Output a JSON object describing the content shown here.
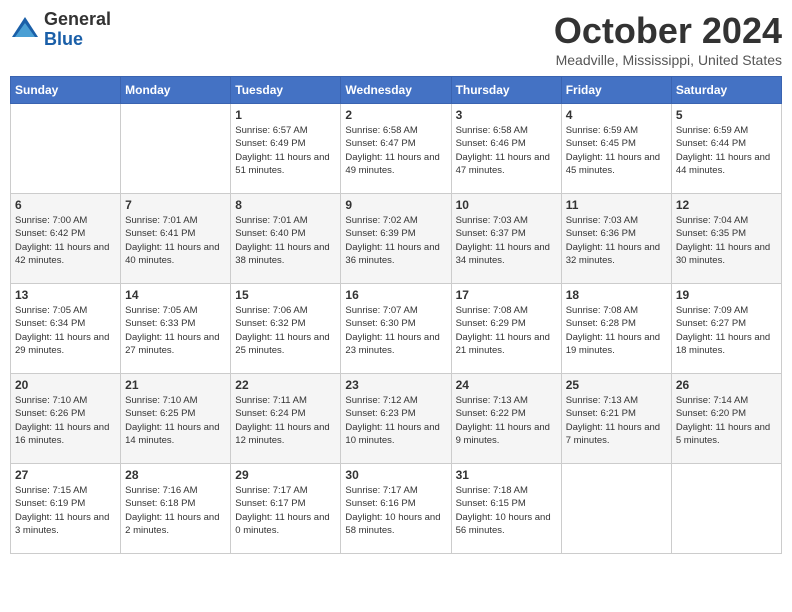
{
  "app": {
    "name_general": "General",
    "name_blue": "Blue"
  },
  "header": {
    "month_title": "October 2024",
    "location": "Meadville, Mississippi, United States"
  },
  "weekdays": [
    "Sunday",
    "Monday",
    "Tuesday",
    "Wednesday",
    "Thursday",
    "Friday",
    "Saturday"
  ],
  "weeks": [
    [
      {
        "day": "",
        "sunrise": "",
        "sunset": "",
        "daylight": ""
      },
      {
        "day": "",
        "sunrise": "",
        "sunset": "",
        "daylight": ""
      },
      {
        "day": "1",
        "sunrise": "Sunrise: 6:57 AM",
        "sunset": "Sunset: 6:49 PM",
        "daylight": "Daylight: 11 hours and 51 minutes."
      },
      {
        "day": "2",
        "sunrise": "Sunrise: 6:58 AM",
        "sunset": "Sunset: 6:47 PM",
        "daylight": "Daylight: 11 hours and 49 minutes."
      },
      {
        "day": "3",
        "sunrise": "Sunrise: 6:58 AM",
        "sunset": "Sunset: 6:46 PM",
        "daylight": "Daylight: 11 hours and 47 minutes."
      },
      {
        "day": "4",
        "sunrise": "Sunrise: 6:59 AM",
        "sunset": "Sunset: 6:45 PM",
        "daylight": "Daylight: 11 hours and 45 minutes."
      },
      {
        "day": "5",
        "sunrise": "Sunrise: 6:59 AM",
        "sunset": "Sunset: 6:44 PM",
        "daylight": "Daylight: 11 hours and 44 minutes."
      }
    ],
    [
      {
        "day": "6",
        "sunrise": "Sunrise: 7:00 AM",
        "sunset": "Sunset: 6:42 PM",
        "daylight": "Daylight: 11 hours and 42 minutes."
      },
      {
        "day": "7",
        "sunrise": "Sunrise: 7:01 AM",
        "sunset": "Sunset: 6:41 PM",
        "daylight": "Daylight: 11 hours and 40 minutes."
      },
      {
        "day": "8",
        "sunrise": "Sunrise: 7:01 AM",
        "sunset": "Sunset: 6:40 PM",
        "daylight": "Daylight: 11 hours and 38 minutes."
      },
      {
        "day": "9",
        "sunrise": "Sunrise: 7:02 AM",
        "sunset": "Sunset: 6:39 PM",
        "daylight": "Daylight: 11 hours and 36 minutes."
      },
      {
        "day": "10",
        "sunrise": "Sunrise: 7:03 AM",
        "sunset": "Sunset: 6:37 PM",
        "daylight": "Daylight: 11 hours and 34 minutes."
      },
      {
        "day": "11",
        "sunrise": "Sunrise: 7:03 AM",
        "sunset": "Sunset: 6:36 PM",
        "daylight": "Daylight: 11 hours and 32 minutes."
      },
      {
        "day": "12",
        "sunrise": "Sunrise: 7:04 AM",
        "sunset": "Sunset: 6:35 PM",
        "daylight": "Daylight: 11 hours and 30 minutes."
      }
    ],
    [
      {
        "day": "13",
        "sunrise": "Sunrise: 7:05 AM",
        "sunset": "Sunset: 6:34 PM",
        "daylight": "Daylight: 11 hours and 29 minutes."
      },
      {
        "day": "14",
        "sunrise": "Sunrise: 7:05 AM",
        "sunset": "Sunset: 6:33 PM",
        "daylight": "Daylight: 11 hours and 27 minutes."
      },
      {
        "day": "15",
        "sunrise": "Sunrise: 7:06 AM",
        "sunset": "Sunset: 6:32 PM",
        "daylight": "Daylight: 11 hours and 25 minutes."
      },
      {
        "day": "16",
        "sunrise": "Sunrise: 7:07 AM",
        "sunset": "Sunset: 6:30 PM",
        "daylight": "Daylight: 11 hours and 23 minutes."
      },
      {
        "day": "17",
        "sunrise": "Sunrise: 7:08 AM",
        "sunset": "Sunset: 6:29 PM",
        "daylight": "Daylight: 11 hours and 21 minutes."
      },
      {
        "day": "18",
        "sunrise": "Sunrise: 7:08 AM",
        "sunset": "Sunset: 6:28 PM",
        "daylight": "Daylight: 11 hours and 19 minutes."
      },
      {
        "day": "19",
        "sunrise": "Sunrise: 7:09 AM",
        "sunset": "Sunset: 6:27 PM",
        "daylight": "Daylight: 11 hours and 18 minutes."
      }
    ],
    [
      {
        "day": "20",
        "sunrise": "Sunrise: 7:10 AM",
        "sunset": "Sunset: 6:26 PM",
        "daylight": "Daylight: 11 hours and 16 minutes."
      },
      {
        "day": "21",
        "sunrise": "Sunrise: 7:10 AM",
        "sunset": "Sunset: 6:25 PM",
        "daylight": "Daylight: 11 hours and 14 minutes."
      },
      {
        "day": "22",
        "sunrise": "Sunrise: 7:11 AM",
        "sunset": "Sunset: 6:24 PM",
        "daylight": "Daylight: 11 hours and 12 minutes."
      },
      {
        "day": "23",
        "sunrise": "Sunrise: 7:12 AM",
        "sunset": "Sunset: 6:23 PM",
        "daylight": "Daylight: 11 hours and 10 minutes."
      },
      {
        "day": "24",
        "sunrise": "Sunrise: 7:13 AM",
        "sunset": "Sunset: 6:22 PM",
        "daylight": "Daylight: 11 hours and 9 minutes."
      },
      {
        "day": "25",
        "sunrise": "Sunrise: 7:13 AM",
        "sunset": "Sunset: 6:21 PM",
        "daylight": "Daylight: 11 hours and 7 minutes."
      },
      {
        "day": "26",
        "sunrise": "Sunrise: 7:14 AM",
        "sunset": "Sunset: 6:20 PM",
        "daylight": "Daylight: 11 hours and 5 minutes."
      }
    ],
    [
      {
        "day": "27",
        "sunrise": "Sunrise: 7:15 AM",
        "sunset": "Sunset: 6:19 PM",
        "daylight": "Daylight: 11 hours and 3 minutes."
      },
      {
        "day": "28",
        "sunrise": "Sunrise: 7:16 AM",
        "sunset": "Sunset: 6:18 PM",
        "daylight": "Daylight: 11 hours and 2 minutes."
      },
      {
        "day": "29",
        "sunrise": "Sunrise: 7:17 AM",
        "sunset": "Sunset: 6:17 PM",
        "daylight": "Daylight: 11 hours and 0 minutes."
      },
      {
        "day": "30",
        "sunrise": "Sunrise: 7:17 AM",
        "sunset": "Sunset: 6:16 PM",
        "daylight": "Daylight: 10 hours and 58 minutes."
      },
      {
        "day": "31",
        "sunrise": "Sunrise: 7:18 AM",
        "sunset": "Sunset: 6:15 PM",
        "daylight": "Daylight: 10 hours and 56 minutes."
      },
      {
        "day": "",
        "sunrise": "",
        "sunset": "",
        "daylight": ""
      },
      {
        "day": "",
        "sunrise": "",
        "sunset": "",
        "daylight": ""
      }
    ]
  ]
}
